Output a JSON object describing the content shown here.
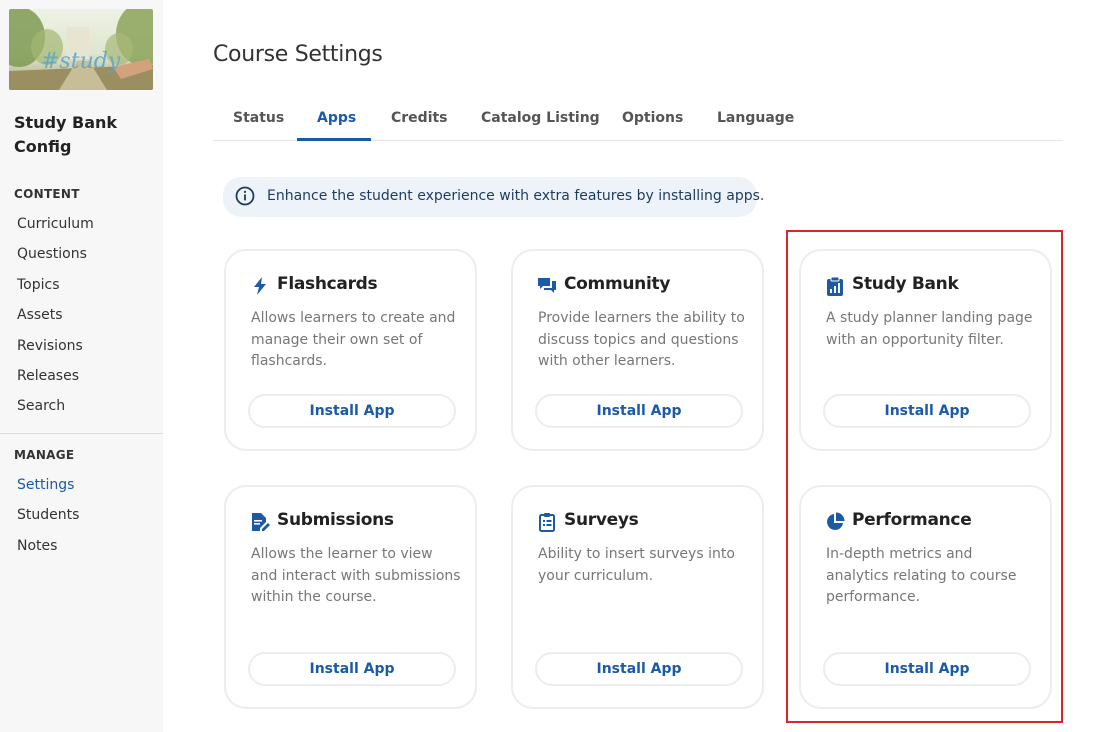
{
  "sidebar": {
    "course_thumbnail_text": "#study",
    "course_name": "Study Bank Config",
    "content_label": "CONTENT",
    "content_items": [
      {
        "label": "Curriculum"
      },
      {
        "label": "Questions"
      },
      {
        "label": "Topics"
      },
      {
        "label": "Assets"
      },
      {
        "label": "Revisions"
      },
      {
        "label": "Releases"
      },
      {
        "label": "Search"
      }
    ],
    "manage_label": "MANAGE",
    "manage_items": [
      {
        "label": "Settings",
        "active": true
      },
      {
        "label": "Students"
      },
      {
        "label": "Notes"
      }
    ]
  },
  "main": {
    "title": "Course Settings",
    "tabs": [
      {
        "label": "Status"
      },
      {
        "label": "Apps",
        "active": true
      },
      {
        "label": "Credits"
      },
      {
        "label": "Catalog Listing"
      },
      {
        "label": "Options"
      },
      {
        "label": "Language"
      }
    ],
    "info_banner": {
      "icon": "info-circle-icon",
      "text": "Enhance the student experience with extra features by installing apps."
    },
    "apps": [
      {
        "title": "Flashcards",
        "icon": "lightning-bolt-icon",
        "description": "Allows learners to create and manage their own set of flashcards.",
        "button": "Install App"
      },
      {
        "title": "Community",
        "icon": "chat-bubbles-icon",
        "description": "Provide learners the ability to discuss topics and questions with other learners.",
        "button": "Install App"
      },
      {
        "title": "Study Bank",
        "icon": "clipboard-chart-icon",
        "description": "A study planner landing page with an opportunity filter.",
        "button": "Install App"
      },
      {
        "title": "Submissions",
        "icon": "file-edit-icon",
        "description": "Allows the learner to view and interact with submissions within the course.",
        "button": "Install App"
      },
      {
        "title": "Surveys",
        "icon": "clipboard-list-icon",
        "description": "Ability to insert surveys into your curriculum.",
        "button": "Install App"
      },
      {
        "title": "Performance",
        "icon": "pie-chart-icon",
        "description": "In-depth metrics and analytics relating to course performance.",
        "button": "Install App"
      }
    ]
  },
  "colors": {
    "accent": "#1a5aa8",
    "highlight": "#d9262b",
    "sidebar_bg": "#f7f7f7",
    "banner_bg": "#eef3f9"
  }
}
